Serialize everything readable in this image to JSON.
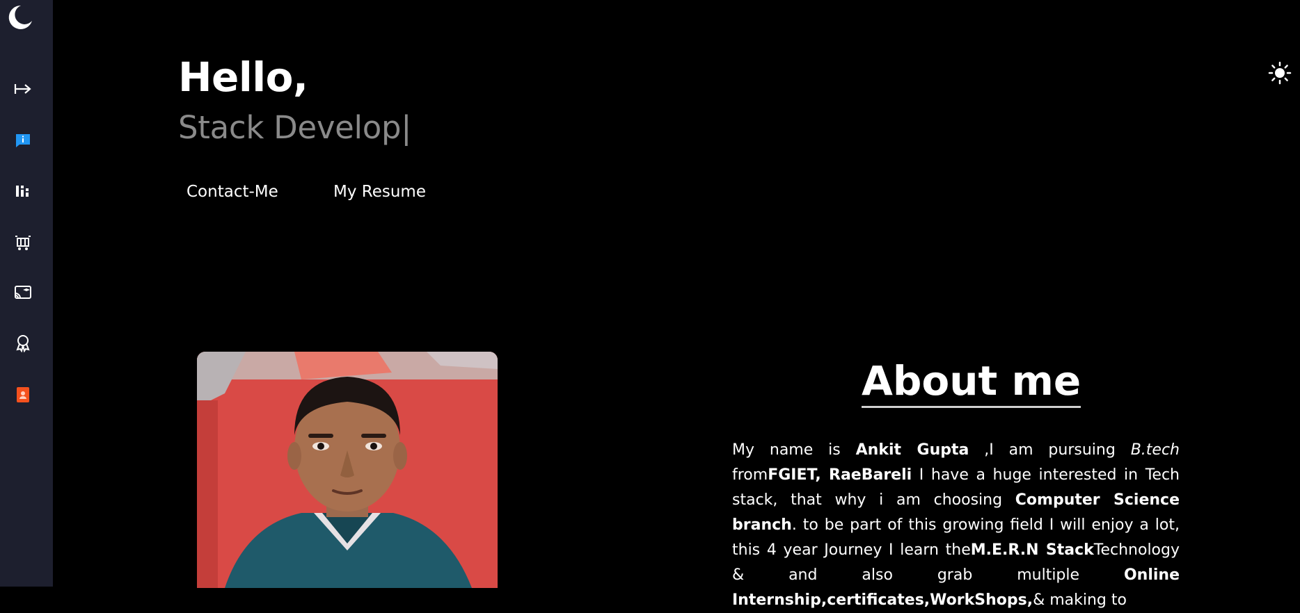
{
  "header": {
    "greeting": "Hello,",
    "typed_role": "Stack Develop",
    "caret": "|"
  },
  "actions": {
    "contact_label": "Contact-Me",
    "resume_label": "My Resume"
  },
  "sidebar": {
    "items": [
      {
        "name": "arrow-right-bar-icon"
      },
      {
        "name": "info-chat-icon",
        "color": "#2196f3"
      },
      {
        "name": "skills-chart-icon"
      },
      {
        "name": "projects-cart-icon"
      },
      {
        "name": "education-cast-icon"
      },
      {
        "name": "certificate-award-icon"
      },
      {
        "name": "contact-book-icon",
        "color": "#f4511e"
      }
    ]
  },
  "theme": {
    "dark_icon": "moon-icon",
    "light_icon": "sun-icon"
  },
  "about": {
    "title": "About me",
    "p1": "My name is ",
    "name": "Ankit Gupta",
    "p2": " ,I am pursuing ",
    "degree": "B.tech",
    "p3": " from",
    "college": "FGIET, RaeBareli",
    "p4": " I have a huge interested in Tech stack, that why i am choosing ",
    "branch": "Computer Science branch",
    "p5": ". to be part of this growing field I will enjoy a lot, this 4 year Journey I learn the",
    "stack": "M.E.R.N Stack",
    "p6": "Technology & and also grab multiple ",
    "extras": "Online Internship,certificates,WorkShops,",
    "p7": "& making to"
  },
  "colors": {
    "sidebar_bg": "#1d1f2e",
    "page_bg": "#000000",
    "typed_text": "#8a8a8a",
    "info_icon": "#2196f3",
    "contact_icon": "#f4511e"
  }
}
